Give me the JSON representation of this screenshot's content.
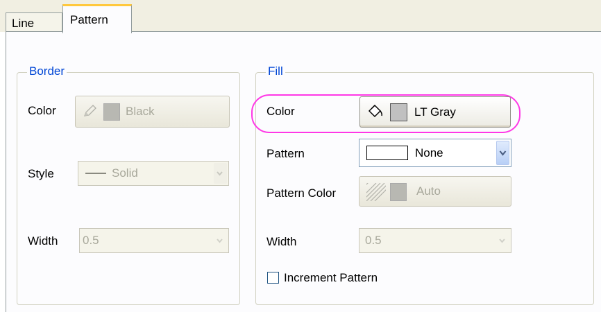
{
  "tabs": [
    {
      "label": "Line",
      "active": false
    },
    {
      "label": "Pattern",
      "active": true
    }
  ],
  "border_group": {
    "title": "Border",
    "color": {
      "label": "Color",
      "value": "Black",
      "swatch": "#a8a8a8",
      "icon": "pencil-icon",
      "enabled": false
    },
    "style": {
      "label": "Style",
      "value": "Solid",
      "icon": "solid-line-icon",
      "enabled": false
    },
    "width": {
      "label": "Width",
      "value": "0.5",
      "enabled": false
    }
  },
  "fill_group": {
    "title": "Fill",
    "color": {
      "label": "Color",
      "value": "LT Gray",
      "swatch": "#c0c0c0",
      "icon": "paint-bucket-icon",
      "enabled": true
    },
    "pattern": {
      "label": "Pattern",
      "value": "None",
      "enabled": true
    },
    "pattern_color": {
      "label": "Pattern Color",
      "value": "Auto",
      "icon": "hatch-pattern-icon",
      "swatch": "#a8a8a8",
      "enabled": false
    },
    "width": {
      "label": "Width",
      "value": "0.5",
      "enabled": false
    },
    "increment_pattern": {
      "label": "Increment Pattern",
      "checked": false
    }
  },
  "colors": {
    "group_title": "#0046d5",
    "highlight": "#ff37e6",
    "disabled_text": "#a8a89b"
  }
}
